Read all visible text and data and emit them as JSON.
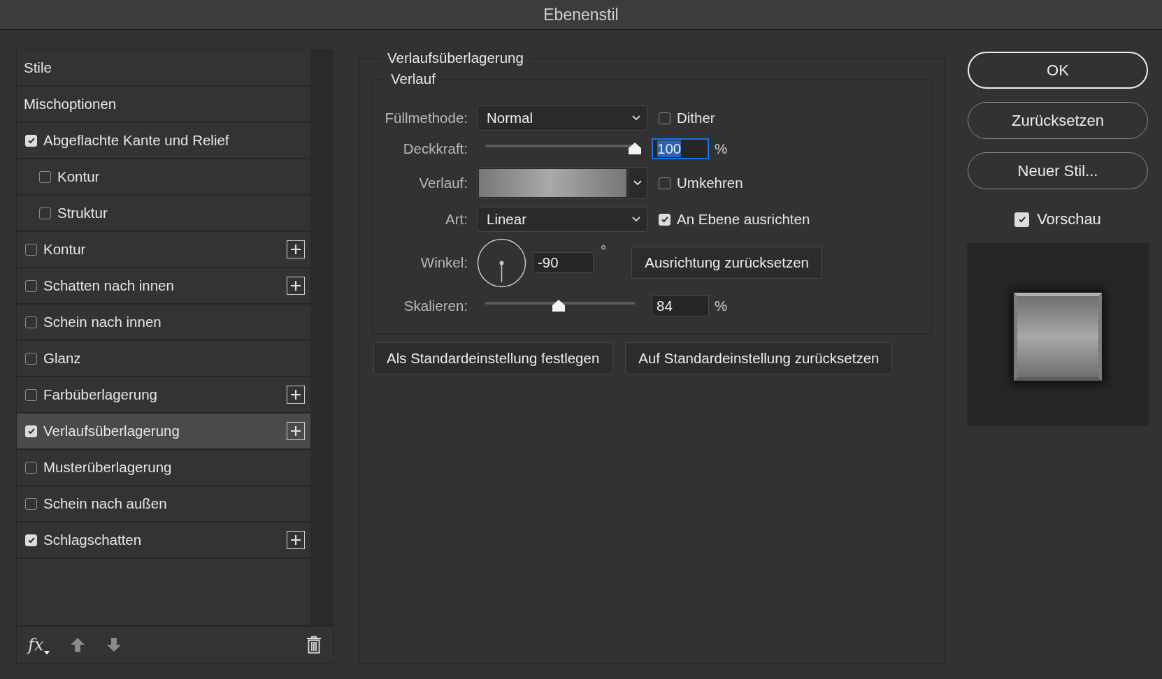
{
  "window": {
    "title": "Ebenenstil"
  },
  "styles_list": {
    "items": [
      {
        "label": "Stile",
        "kind": "plain",
        "selected": false,
        "addable": false
      },
      {
        "label": "Mischoptionen",
        "kind": "plain",
        "selected": false,
        "addable": false
      },
      {
        "label": "Abgeflachte Kante und Relief",
        "kind": "checkbox",
        "checked": true,
        "selected": false,
        "addable": false,
        "children": [
          {
            "label": "Kontur",
            "kind": "checkbox",
            "checked": false,
            "selected": false,
            "addable": false
          },
          {
            "label": "Struktur",
            "kind": "checkbox",
            "checked": false,
            "selected": false,
            "addable": false
          }
        ]
      },
      {
        "label": "Kontur",
        "kind": "checkbox",
        "checked": false,
        "selected": false,
        "addable": true
      },
      {
        "label": "Schatten nach innen",
        "kind": "checkbox",
        "checked": false,
        "selected": false,
        "addable": true
      },
      {
        "label": "Schein nach innen",
        "kind": "checkbox",
        "checked": false,
        "selected": false,
        "addable": false
      },
      {
        "label": "Glanz",
        "kind": "checkbox",
        "checked": false,
        "selected": false,
        "addable": false
      },
      {
        "label": "Farbüberlagerung",
        "kind": "checkbox",
        "checked": false,
        "selected": false,
        "addable": true
      },
      {
        "label": "Verlaufsüberlagerung",
        "kind": "checkbox",
        "checked": true,
        "selected": true,
        "addable": true
      },
      {
        "label": "Musterüberlagerung",
        "kind": "checkbox",
        "checked": false,
        "selected": false,
        "addable": false
      },
      {
        "label": "Schein nach außen",
        "kind": "checkbox",
        "checked": false,
        "selected": false,
        "addable": false
      },
      {
        "label": "Schlagschatten",
        "kind": "checkbox",
        "checked": true,
        "selected": false,
        "addable": true
      }
    ],
    "footer": {
      "fx_label": "fx"
    }
  },
  "gradient_overlay": {
    "title": "Verlaufsüberlagerung",
    "group_title": "Verlauf",
    "blend_mode": {
      "label": "Füllmethode:",
      "value": "Normal"
    },
    "dither": {
      "label": "Dither",
      "checked": false
    },
    "opacity": {
      "label": "Deckkraft:",
      "level": 1.0,
      "value": "100",
      "unit": "%",
      "focused": true
    },
    "gradient": {
      "label": "Verlauf:"
    },
    "reverse": {
      "label": "Umkehren",
      "checked": false
    },
    "style": {
      "label": "Art:",
      "value": "Linear"
    },
    "align_with_layer": {
      "label": "An Ebene ausrichten",
      "checked": true
    },
    "angle": {
      "label": "Winkel:",
      "value": "-90",
      "unit": "°"
    },
    "reset_alignment": "Ausrichtung zurücksetzen",
    "scale": {
      "label": "Skalieren:",
      "level": 0.49,
      "value": "84",
      "unit": "%",
      "focused": false
    },
    "buttons": [
      "Als Standardeinstellung festlegen",
      "Auf Standardeinstellung zurücksetzen"
    ]
  },
  "actions": {
    "buttons": [
      {
        "label": "OK",
        "default": true
      },
      {
        "label": "Zurücksetzen",
        "default": false
      },
      {
        "label": "Neuer Stil...",
        "default": false
      }
    ],
    "preview": {
      "label": "Vorschau",
      "checked": true
    }
  }
}
